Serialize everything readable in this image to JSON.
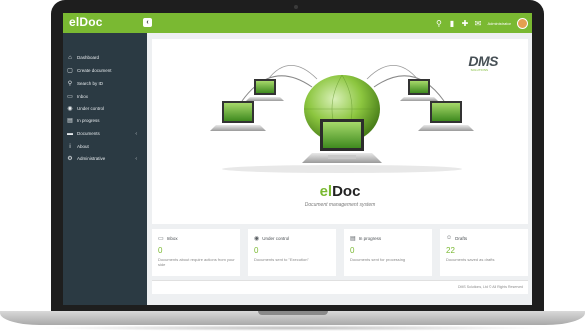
{
  "app": {
    "logo": "elDoc",
    "collapse_icon": "chevron-left-icon"
  },
  "topbar": {
    "icons": [
      "search-icon",
      "bookmark-icon",
      "puzzle-icon",
      "chat-icon"
    ],
    "user_name": "Administrator",
    "colors": {
      "bar": "#7ab932",
      "sidebar": "#2b3a43"
    }
  },
  "sidebar": {
    "items": [
      {
        "label": "Dashboard",
        "icon": "home-icon"
      },
      {
        "label": "Create document",
        "icon": "file-icon"
      },
      {
        "label": "Search by ID",
        "icon": "search-icon"
      },
      {
        "label": "Inbox",
        "icon": "inbox-icon"
      },
      {
        "label": "Under control",
        "icon": "eye-icon"
      },
      {
        "label": "In progress",
        "icon": "tasks-icon"
      },
      {
        "label": "Documents",
        "icon": "folder-icon"
      },
      {
        "label": "About",
        "icon": "info-icon"
      },
      {
        "label": "Administrative",
        "icon": "gears-icon"
      }
    ]
  },
  "hero": {
    "brand_logo": "DMS",
    "brand_sub": "SOLUTIONS",
    "title_part1": "el",
    "title_part2": "Doc",
    "subtitle": "Document management system"
  },
  "cards": [
    {
      "title": "Inbox",
      "icon": "inbox-icon",
      "count": "0",
      "desc": "Documents about require actions from your side"
    },
    {
      "title": "Under control",
      "icon": "eye-icon",
      "count": "0",
      "desc": "Documents sent to \"Execution\""
    },
    {
      "title": "In progress",
      "icon": "tasks-icon",
      "count": "0",
      "desc": "Documents sent for processing"
    },
    {
      "title": "Drafts",
      "icon": "user-icon",
      "count": "22",
      "desc": "Documents saved as drafts"
    }
  ],
  "footer": {
    "text": "DMS Solutions, Ltd © All Rights Reserved"
  }
}
